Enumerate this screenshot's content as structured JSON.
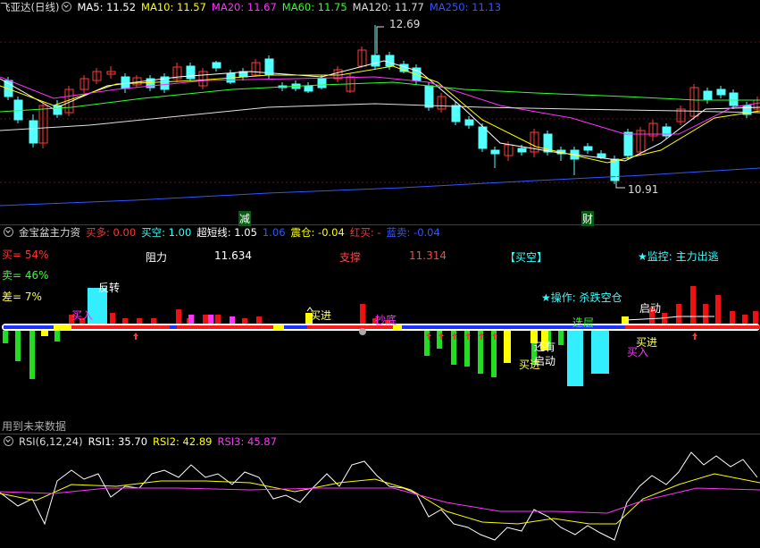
{
  "main_panel": {
    "title": "飞亚达(日线)",
    "indicators": [
      {
        "label": "MA5: 11.52",
        "color": "#ffffff"
      },
      {
        "label": "MA10: 11.57",
        "color": "#ffff00"
      },
      {
        "label": "MA20: 11.67",
        "color": "#ff33ff"
      },
      {
        "label": "MA60: 11.75",
        "color": "#33ff33"
      },
      {
        "label": "MA120: 11.77",
        "color": "#dddddd"
      },
      {
        "label": "MA250: 11.13",
        "color": "#3355ff"
      }
    ],
    "high_label": "12.69",
    "low_label": "10.91",
    "markers": [
      {
        "text": "减"
      },
      {
        "text": "财"
      }
    ]
  },
  "sub_panel": {
    "title": "金宝盆主力资",
    "indicators": [
      {
        "label": "买多: 0.00",
        "color": "#ff3333"
      },
      {
        "label": "买空: 1.00",
        "color": "#33ffff"
      },
      {
        "label": "超短线: 1.05",
        "color": "#ffffff"
      },
      {
        "label": "1.06",
        "color": "#3355ff"
      },
      {
        "label": "震仓: -0.04",
        "color": "#ffff00"
      },
      {
        "label": "红买: -",
        "color": "#ff3333"
      },
      {
        "label": "蓝卖: -0.04",
        "color": "#3355ff"
      }
    ],
    "stats": {
      "buy": "买= 54%",
      "sell": "卖= 46%",
      "diff": "差= 7%"
    },
    "resistance_label": "阻力",
    "resistance_value": "11.634",
    "support_label": "支撑",
    "support_value": "11.314",
    "status": "【买空】",
    "monitor": "★监控: 主力出逃",
    "operation": "★操作: 杀跌空仓",
    "annotations": [
      {
        "text": "反转"
      },
      {
        "text": "买入"
      },
      {
        "text": "买进"
      },
      {
        "text": "抄底"
      },
      {
        "text": "还有"
      },
      {
        "text": "启动"
      },
      {
        "text": "买进"
      },
      {
        "text": "选层"
      },
      {
        "text": "启动"
      },
      {
        "text": "买进"
      },
      {
        "text": "买入"
      }
    ],
    "footer": "用到未来数据"
  },
  "rsi_panel": {
    "title": "RSI(6,12,24)",
    "indicators": [
      {
        "label": "RSI1: 35.70",
        "color": "#ffffff"
      },
      {
        "label": "RSI2: 42.89",
        "color": "#ffff00"
      },
      {
        "label": "RSI3: 45.87",
        "color": "#ff33ff"
      }
    ]
  },
  "chart_data": {
    "type": "candlestick",
    "price_high": 12.69,
    "price_low": 10.91,
    "ma_lines": [
      "MA5",
      "MA10",
      "MA20",
      "MA60",
      "MA120",
      "MA250"
    ]
  }
}
